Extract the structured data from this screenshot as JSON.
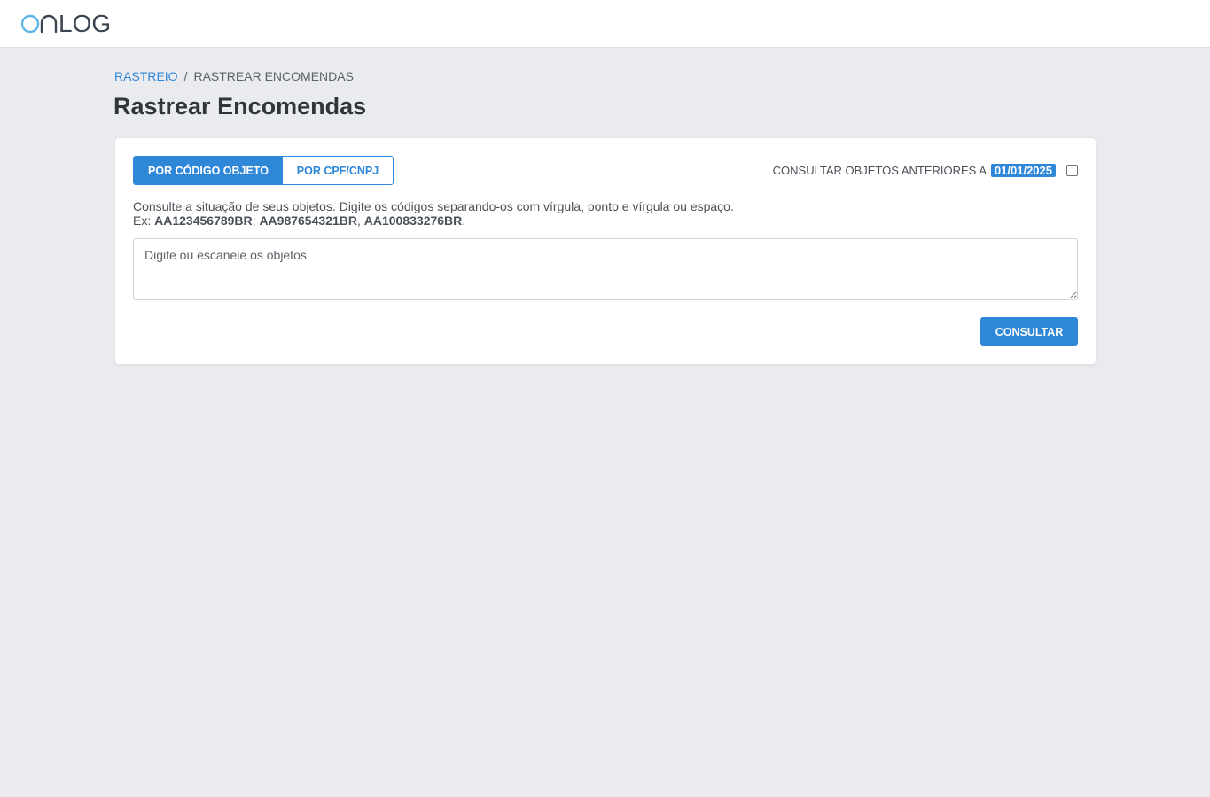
{
  "header": {
    "logo_text": "LOG",
    "logo_alt": "ONLOG"
  },
  "breadcrumb": {
    "root": "RASTREIO",
    "separator": "/",
    "current": "RASTREAR ENCOMENDAS"
  },
  "page": {
    "title": "Rastrear Encomendas"
  },
  "search": {
    "tabs": [
      {
        "label": "POR CÓDIGO OBJETO",
        "active": true
      },
      {
        "label": "POR CPF/CNPJ",
        "active": false
      }
    ],
    "previous_objects_label": "CONSULTAR OBJETOS ANTERIORES A",
    "previous_objects_date": "01/01/2025",
    "previous_objects_checked": false,
    "help_line1": "Consulte a situação de seus objetos. Digite os códigos separando-os com vírgula, ponto e vírgula ou espaço.",
    "help_prefix": "Ex: ",
    "example_codes": [
      "AA123456789BR",
      "AA987654321BR",
      "AA100833276BR"
    ],
    "example_separators": [
      "; ",
      ", ",
      "."
    ],
    "placeholder": "Digite ou escaneie os objetos",
    "value": "",
    "submit_label": "CONSULTAR"
  },
  "colors": {
    "primary": "#2f87d8",
    "background": "#e9ebee",
    "card": "#ffffff",
    "text": "#343a40"
  }
}
